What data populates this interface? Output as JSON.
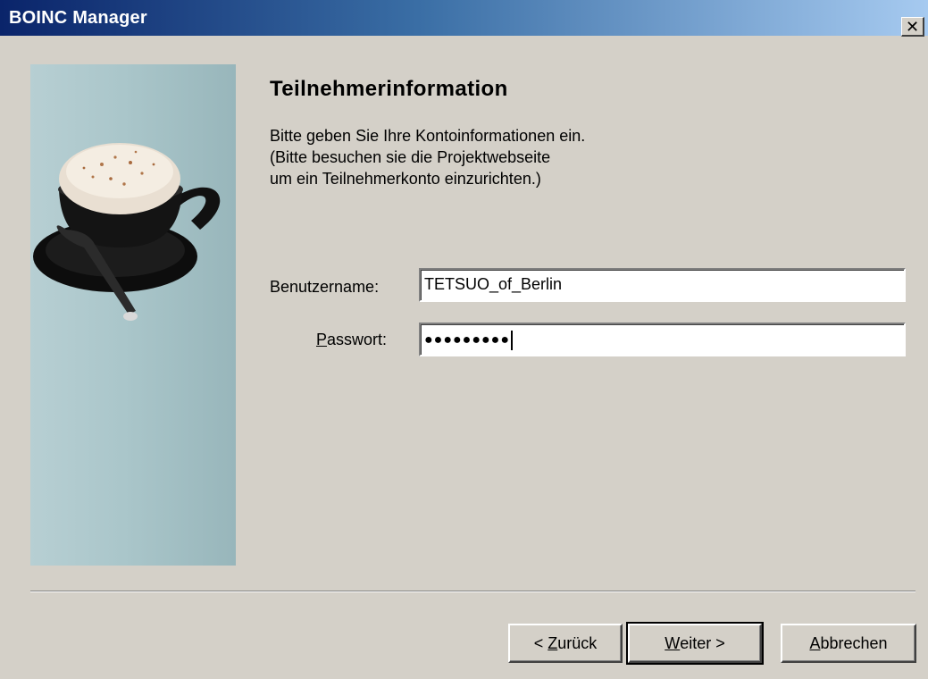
{
  "window": {
    "title": "BOINC Manager",
    "close_glyph": "✕"
  },
  "wizard": {
    "heading": "Teilnehmerinformation",
    "description": [
      "Bitte geben Sie Ihre Kontoinformationen ein.",
      "(Bitte besuchen sie die Projektwebseite",
      "um ein Teilnehmerkonto einzurichten.)"
    ],
    "username": {
      "label": "Benutzername:",
      "value": "TETSUO_of_Berlin"
    },
    "password": {
      "label_accel": "P",
      "label_rest": "asswort:",
      "value_masked": "●●●●●●●●●"
    }
  },
  "buttons": {
    "back": {
      "prefix": "< ",
      "accel": "Z",
      "rest": "urück"
    },
    "next": {
      "accel": "W",
      "rest": "eiter >"
    },
    "cancel": {
      "accel": "A",
      "rest": "bbrechen"
    }
  },
  "colors": {
    "titlebar_start": "#0a246a",
    "titlebar_end": "#a6caf0",
    "dialog_bg": "#d4d0c8",
    "side_panel": "#aac6ca"
  },
  "icons": {
    "side_image": "coffee-cup-image"
  }
}
